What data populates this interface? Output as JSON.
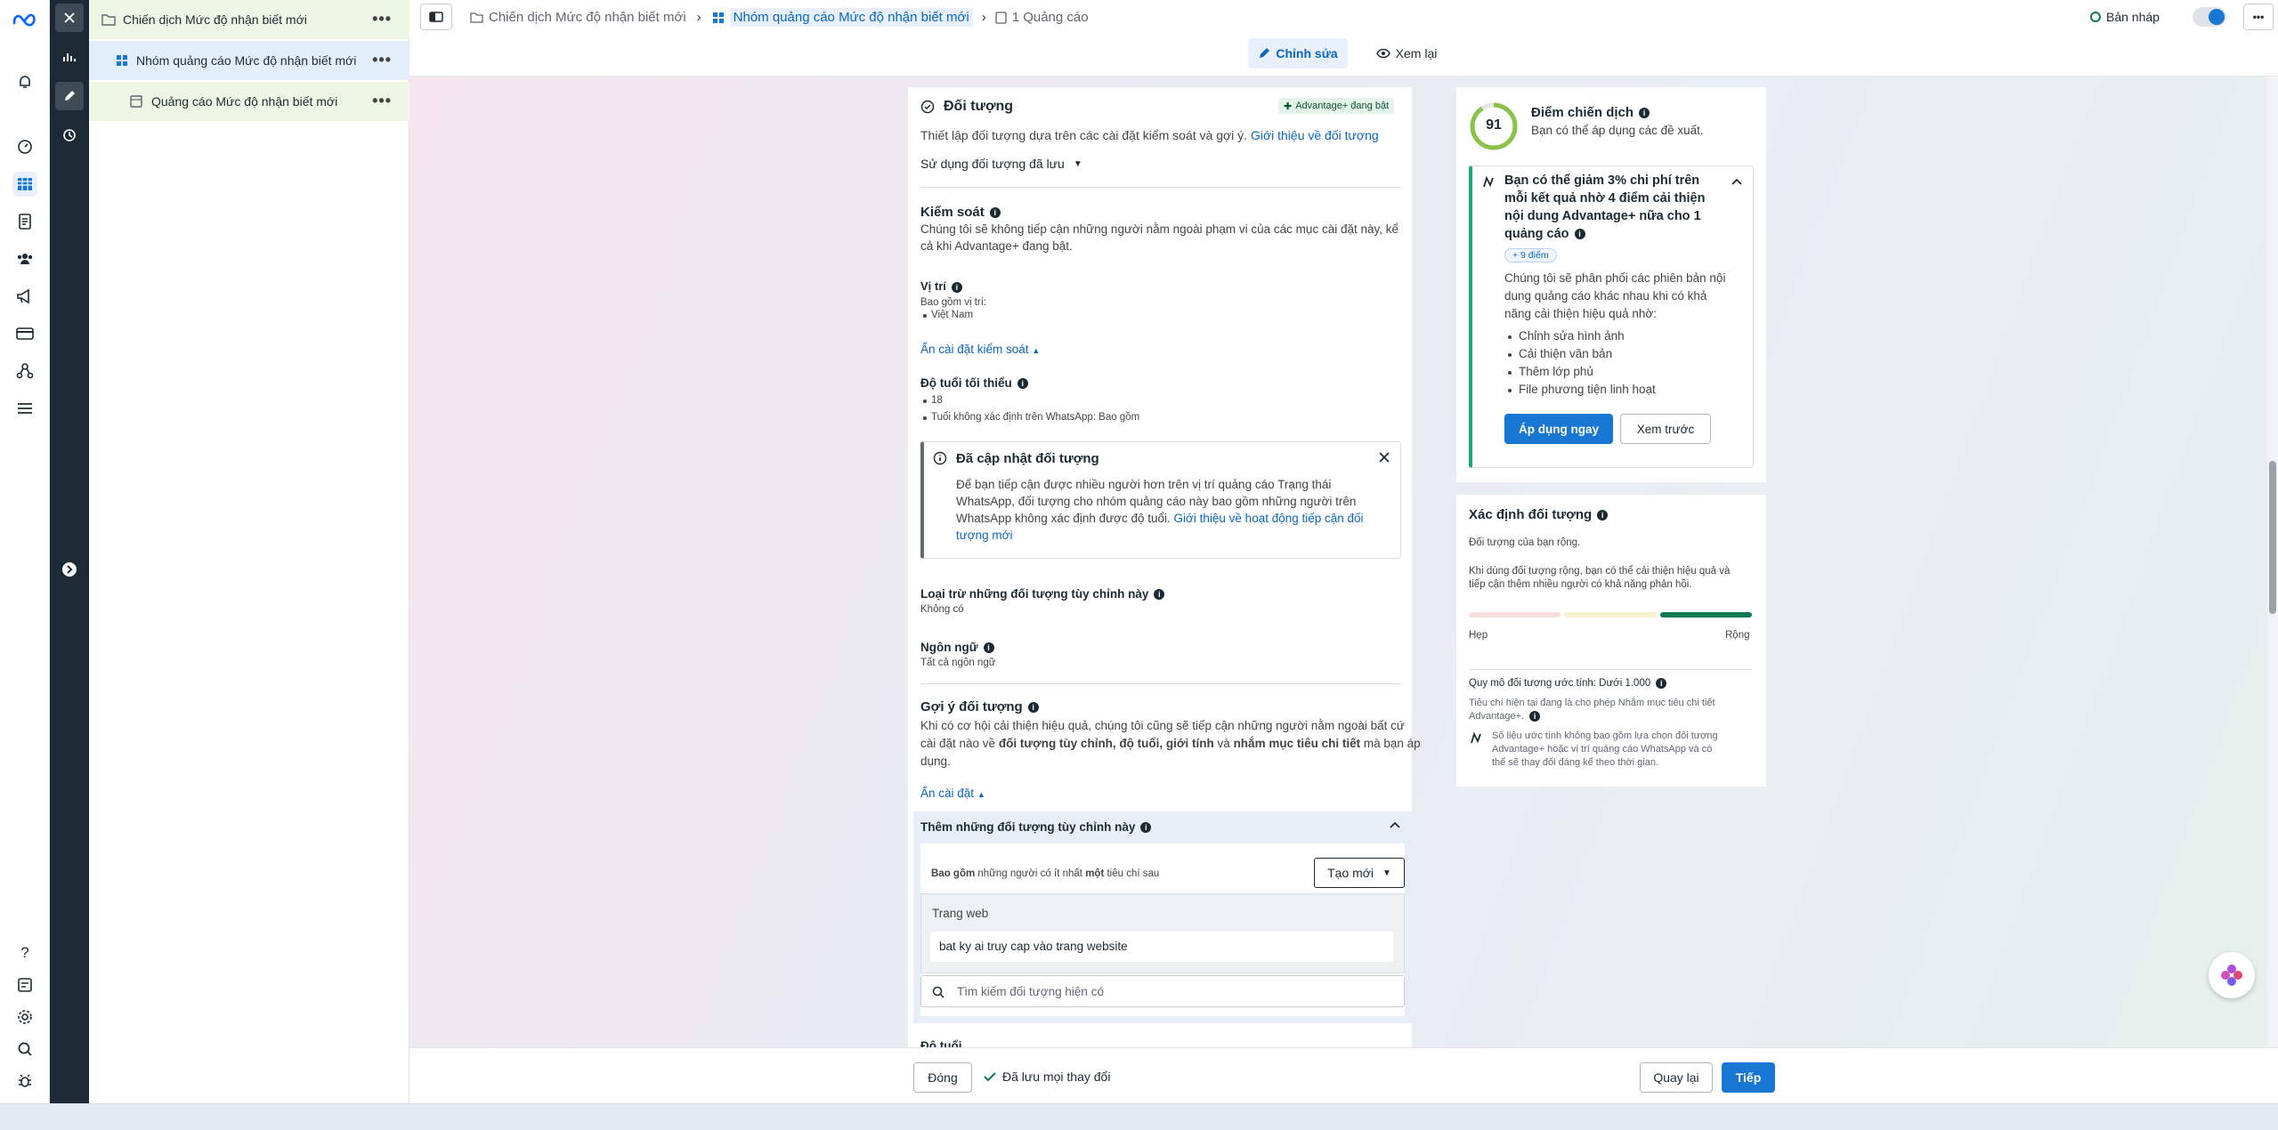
{
  "rail": {
    "icons": [
      "meta-logo-icon",
      "bell-icon",
      "gauge-icon",
      "table-icon",
      "document-icon",
      "people-icon",
      "megaphone-icon",
      "billing-icon",
      "network-icon",
      "menu-icon",
      "help-icon",
      "notes-icon",
      "settings-icon",
      "search-icon",
      "bug-icon"
    ]
  },
  "tree": {
    "items": [
      {
        "label": "Chiến dịch Mức độ nhận biết mới",
        "more": "•••"
      },
      {
        "label": "Nhóm quảng cáo Mức độ nhận biết mới",
        "more": "•••"
      },
      {
        "label": "Quảng cáo Mức độ nhận biết mới",
        "more": "•••"
      }
    ]
  },
  "topbar": {
    "crumbs": [
      "Chiến dịch Mức độ nhận biết mới",
      "Nhóm quảng cáo Mức độ nhận biết mới",
      "1 Quảng cáo"
    ],
    "separator": "›",
    "draft_label": "Bản nháp",
    "more": "•••",
    "edit_tab": "Chỉnh sửa",
    "review_tab": "Xem lại"
  },
  "audience": {
    "title": "Đối tượng",
    "adv_badge": "Advantage+ đang bật",
    "subtitle": "Thiết lập đối tượng dựa trên các cài đặt kiểm soát và gợi ý.",
    "subtitle_link": "Giới thiệu về đối tượng",
    "saved_dropdown": "Sử dụng đối tượng đã lưu",
    "control_title": "Kiểm soát",
    "control_desc_1": "Chúng tôi sẽ không tiếp cận những người nằm ngoài phạm vi của các mục cài đặt này, kể",
    "control_desc_2": "cả khi Advantage+ đang bật.",
    "location_label": "Vị trí",
    "location_include": "Bao gồm vị trí:",
    "location_value": "Việt Nam",
    "hide_controls": "Ẩn cài đặt kiểm soát",
    "min_age_label": "Độ tuổi tối thiểu",
    "min_age_value": "18",
    "whatsapp_age": "Tuổi không xác định trên WhatsApp: Bao gồm",
    "notice_title": "Đã cập nhật đối tượng",
    "notice_line1": "Để bạn tiếp cận được nhiều người hơn trên vị trí quảng cáo Trạng thái",
    "notice_line2": "WhatsApp, đối tượng cho nhóm quảng cáo này bao gồm những người trên",
    "notice_line3": "WhatsApp không xác định được độ tuổi.",
    "notice_link_a": "Giới thiệu về hoạt động tiếp cận đối",
    "notice_link_b": "tượng mới",
    "exclude_label": "Loại trừ những đối tượng tùy chỉnh này",
    "exclude_value": "Không có",
    "language_label": "Ngôn ngữ",
    "language_value": "Tất cả ngôn ngữ",
    "suggest_title": "Gợi ý đối tượng",
    "suggest_desc_1": "Khi có cơ hội cải thiện hiệu quả, chúng tôi cũng sẽ tiếp cận những người nằm ngoài bất cứ",
    "suggest_desc_2a": "cài đặt nào về",
    "suggest_desc_2b": "đối tượng tùy chỉnh, độ tuổi, giới tính",
    "suggest_desc_2c": "và",
    "suggest_desc_2d": "nhắm mục tiêu chi tiết",
    "suggest_desc_2e": "mà bạn áp",
    "suggest_desc_3": "dụng.",
    "hide_settings": "Ẩn cài đặt",
    "custom_title": "Thêm những đối tượng tùy chỉnh này",
    "include_a": "Bao gồm",
    "include_b": "những người có ít nhất",
    "include_c": "một",
    "include_d": "tiêu chí sau",
    "create_new": "Tạo mới",
    "website_label": "Trang web",
    "website_value": "bat ky ai truy cap vào trang website",
    "search_placeholder": "Tìm kiếm đối tượng hiện có",
    "age_label_cut": "Độ tuổi"
  },
  "score": {
    "value": "91",
    "title": "Điểm chiến dịch",
    "subtitle": "Bạn có thể áp dụng các đề xuất.",
    "rec_line1": "Bạn có thể giảm 3% chi phí trên",
    "rec_line2": "mỗi kết quả nhờ 4 điểm cải thiện",
    "rec_line3": "nội dung Advantage+ nữa cho 1",
    "rec_line4": "quảng cáo",
    "points": "+ 9 điểm",
    "desc1": "Chúng tôi sẽ phân phối các phiên bản nội",
    "desc2": "dung quảng cáo khác nhau khi có khả",
    "desc3": "năng cải thiện hiệu quả nhờ:",
    "items": [
      "Chỉnh sửa hình ảnh",
      "Cải thiện văn bản",
      "Thêm lớp phủ",
      "File phương tiện linh hoạt"
    ],
    "apply": "Áp dụng ngay",
    "preview": "Xem trước"
  },
  "definition": {
    "title": "Xác định đối tượng",
    "status": "Đối tượng của bạn rộng.",
    "desc1": "Khi dùng đối tượng rộng, bạn có thể cải thiện hiệu quả và",
    "desc2": "tiếp cận thêm nhiều người có khả năng phản hồi.",
    "narrow": "Hẹp",
    "broad": "Rộng",
    "size": "Quy mô đối tượng ước tính: Dưới 1.000",
    "criteria1": "Tiêu chí hiện tại đang là cho phép Nhắm mục tiêu chi tiết",
    "criteria2": "Advantage+.",
    "note1": "Số liệu ước tính không bao gồm lựa chọn đối tượng",
    "note2": "Advantage+ hoặc vị trí quảng cáo WhatsApp và có",
    "note3": "thể sẽ thay đổi đáng kể theo thời gian.",
    "meter_level": "broad",
    "colors": {
      "narrow": "#f9dede",
      "mid": "#f7f1cf",
      "broad": "#0f7a4f"
    }
  },
  "footer": {
    "close": "Đóng",
    "saved": "Đã lưu mọi thay đổi",
    "back": "Quay lại",
    "next": "Tiếp"
  },
  "colors": {
    "accent": "#1877d2",
    "rail_dark": "#1c2b33",
    "tree_bg": "#eef6e5",
    "success": "#0f7a4f"
  }
}
